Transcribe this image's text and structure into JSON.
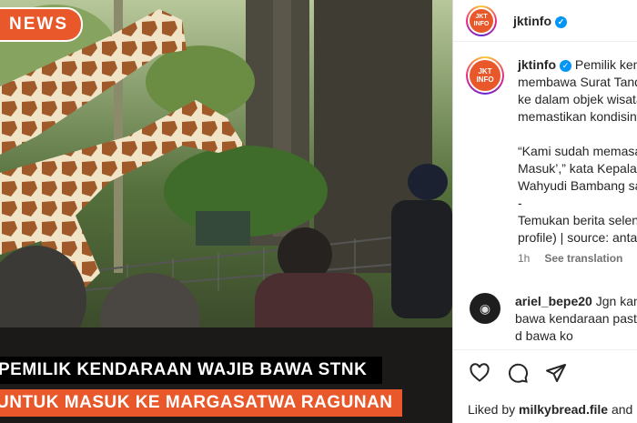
{
  "post_image": {
    "badge": "NEWS",
    "headline_line1": "PEMILIK KENDARAAN WAJIB BAWA STNK",
    "headline_line2": "UNTUK MASUK KE MARGASATWA RAGUNAN"
  },
  "header": {
    "avatar_text": "JKT INFO",
    "username": "jktinfo",
    "verified_icon": "verified-badge-icon"
  },
  "caption": {
    "username": "jktinfo",
    "lines": [
      "Pemilik kendaraan wajib",
      "membawa Surat Tanda Nomor",
      "ke dalam objek wisata",
      "memastikan kondisinya",
      "",
      "“Kami sudah memasang",
      "Masuk’,” kata Kepala",
      "Wahyudi Bambang saat",
      "-",
      "Temukan berita selengkapnya",
      "profile) | source: antaranews"
    ],
    "time": "1h",
    "see_translation": "See translation"
  },
  "comment": {
    "username": "ariel_bepe20",
    "lines": [
      "Jgn kan",
      "bawa kendaraan pasti",
      "d bawa ko"
    ]
  },
  "actions": {
    "like_icon": "heart-icon",
    "comment_icon": "comment-icon",
    "share_icon": "share-icon"
  },
  "likes": {
    "prefix": "Liked by",
    "user": "milkybread.file",
    "suffix": "and"
  },
  "colors": {
    "accent_orange": "#e8582a",
    "verified_blue": "#0095f6",
    "muted_text": "#737373"
  }
}
